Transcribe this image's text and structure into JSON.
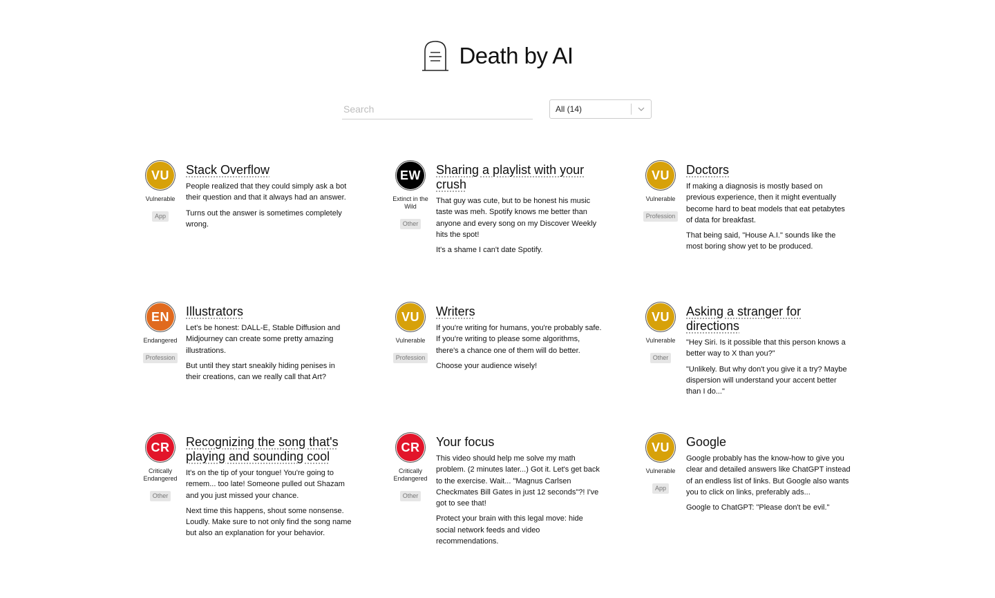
{
  "header": {
    "title": "Death by AI",
    "logo_icon": "tombstone-icon"
  },
  "search": {
    "placeholder": "Search",
    "value": ""
  },
  "filter": {
    "selected": "All (14)"
  },
  "colors": {
    "vulnerable": "#d7a10a",
    "extinct": "#000000",
    "endangered": "#e06a1e",
    "critical": "#e2152a"
  },
  "cards": [
    {
      "title": "Stack Overflow",
      "abbr": "VU",
      "status": "Vulnerable",
      "category": "App",
      "paragraphs": [
        "People realized that they could simply ask a bot their question and that it always had an answer.",
        "Turns out the answer is sometimes completely wrong."
      ]
    },
    {
      "title": "Sharing a playlist with your crush",
      "abbr": "EW",
      "status": "Extinct in the Wild",
      "category": "Other",
      "paragraphs": [
        "That guy was cute, but to be honest his music taste was meh. Spotify knows me better than anyone and every song on my Discover Weekly hits the spot!",
        "It's a shame I can't date Spotify."
      ]
    },
    {
      "title": "Doctors",
      "abbr": "VU",
      "status": "Vulnerable",
      "category": "Profession",
      "paragraphs": [
        "If making a diagnosis is mostly based on previous experience, then it might eventually become hard to beat models that eat petabytes of data for breakfast.",
        "That being said, \"House A.I.\" sounds like the most boring show yet to be produced."
      ]
    },
    {
      "title": "Illustrators",
      "abbr": "EN",
      "status": "Endangered",
      "category": "Profession",
      "paragraphs": [
        "Let's be honest: DALL-E, Stable Diffusion and Midjourney can create some pretty amazing illustrations.",
        "But until they start sneakily hiding penises in their creations, can we really call that Art?"
      ]
    },
    {
      "title": "Writers",
      "abbr": "VU",
      "status": "Vulnerable",
      "category": "Profession",
      "paragraphs": [
        "If you're writing for humans, you're probably safe. If you're writing to please some algorithms, there's a chance one of them will do better.",
        "Choose your audience wisely!"
      ]
    },
    {
      "title": "Asking a stranger for directions",
      "abbr": "VU",
      "status": "Vulnerable",
      "category": "Other",
      "paragraphs": [
        "\"Hey Siri. Is it possible that this person knows a better way to X than you?\"",
        "\"Unlikely. But why don't you give it a try? Maybe dispersion will understand your accent better than I do...\""
      ]
    },
    {
      "title": "Recognizing the song that's playing and sounding cool",
      "abbr": "CR",
      "status": "Critically Endangered",
      "category": "Other",
      "paragraphs": [
        "It's on the tip of your tongue! You're going to remem... too late! Someone pulled out Shazam and you just missed your chance.",
        "Next time this happens, shout some nonsense. Loudly. Make sure to not only find the song name but also an explanation for your behavior."
      ]
    },
    {
      "title": "Your focus",
      "abbr": "CR",
      "status": "Critically Endangered",
      "category": "Other",
      "paragraphs": [
        "This video should help me solve my math problem. (2 minutes later...) Got it. Let's get back to the exercise. Wait... \"Magnus Carlsen Checkmates Bill Gates in just 12 seconds\"?! I've got to see that!",
        "Protect your brain with this legal move: hide social network feeds and video recommendations."
      ]
    },
    {
      "title": "Google",
      "abbr": "VU",
      "status": "Vulnerable",
      "category": "App",
      "paragraphs": [
        "Google probably has the know-how to give you clear and detailed answers like ChatGPT instead of an endless list of links. But Google also wants you to click on links, preferably ads...",
        "Google to ChatGPT: \"Please don't be evil.\""
      ]
    }
  ]
}
